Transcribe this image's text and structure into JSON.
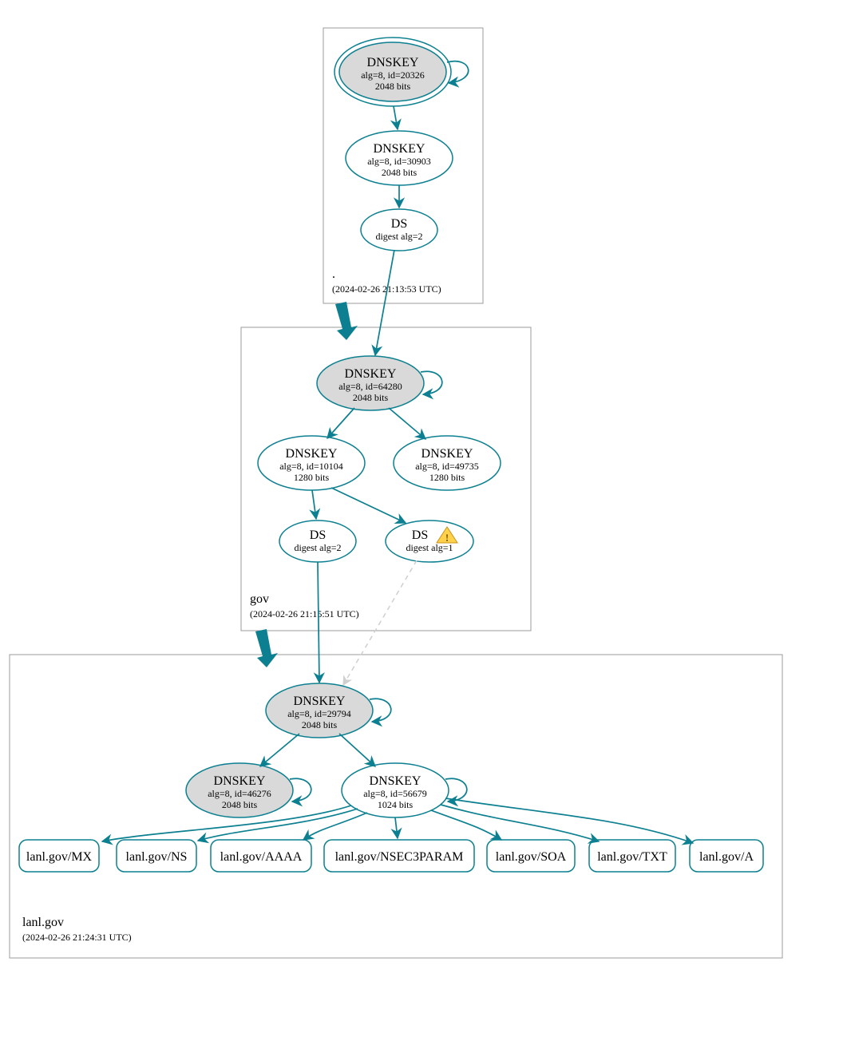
{
  "colors": {
    "stroke": "#0c8091",
    "shaded": "#d9d9d9",
    "box": "#9b9b9b",
    "dashed": "#cfcfcf"
  },
  "zones": {
    "root": {
      "label": ".",
      "timestamp": "(2024-02-26 21:13:53 UTC)"
    },
    "gov": {
      "label": "gov",
      "timestamp": "(2024-02-26 21:15:51 UTC)"
    },
    "lanl": {
      "label": "lanl.gov",
      "timestamp": "(2024-02-26 21:24:31 UTC)"
    }
  },
  "nodes": {
    "root_ksk": {
      "title": "DNSKEY",
      "l1": "alg=8, id=20326",
      "l2": "2048 bits"
    },
    "root_zsk": {
      "title": "DNSKEY",
      "l1": "alg=8, id=30903",
      "l2": "2048 bits"
    },
    "root_ds": {
      "title": "DS",
      "l1": "digest alg=2"
    },
    "gov_ksk": {
      "title": "DNSKEY",
      "l1": "alg=8, id=64280",
      "l2": "2048 bits"
    },
    "gov_zsk1": {
      "title": "DNSKEY",
      "l1": "alg=8, id=10104",
      "l2": "1280 bits"
    },
    "gov_zsk2": {
      "title": "DNSKEY",
      "l1": "alg=8, id=49735",
      "l2": "1280 bits"
    },
    "gov_ds1": {
      "title": "DS",
      "l1": "digest alg=2"
    },
    "gov_ds2": {
      "title": "DS",
      "l1": "digest alg=1"
    },
    "lanl_ksk": {
      "title": "DNSKEY",
      "l1": "alg=8, id=29794",
      "l2": "2048 bits"
    },
    "lanl_zsk1": {
      "title": "DNSKEY",
      "l1": "alg=8, id=46276",
      "l2": "2048 bits"
    },
    "lanl_zsk2": {
      "title": "DNSKEY",
      "l1": "alg=8, id=56679",
      "l2": "1024 bits"
    }
  },
  "rrsets": {
    "mx": "lanl.gov/MX",
    "ns": "lanl.gov/NS",
    "aaaa": "lanl.gov/AAAA",
    "n3p": "lanl.gov/NSEC3PARAM",
    "soa": "lanl.gov/SOA",
    "txt": "lanl.gov/TXT",
    "a": "lanl.gov/A"
  },
  "chart_data": {
    "type": "diagram",
    "description": "DNSSEC authentication/delegation graph",
    "zones": [
      {
        "name": ".",
        "analyzed": "2024-02-26 21:13:53 UTC"
      },
      {
        "name": "gov",
        "analyzed": "2024-02-26 21:15:51 UTC"
      },
      {
        "name": "lanl.gov",
        "analyzed": "2024-02-26 21:24:31 UTC"
      }
    ],
    "nodes": [
      {
        "id": "root_ksk",
        "zone": ".",
        "type": "DNSKEY",
        "alg": 8,
        "key_id": 20326,
        "bits": 2048,
        "role": "KSK",
        "trust_anchor": true
      },
      {
        "id": "root_zsk",
        "zone": ".",
        "type": "DNSKEY",
        "alg": 8,
        "key_id": 30903,
        "bits": 2048,
        "role": "ZSK"
      },
      {
        "id": "root_ds",
        "zone": ".",
        "type": "DS",
        "digest_alg": 2
      },
      {
        "id": "gov_ksk",
        "zone": "gov",
        "type": "DNSKEY",
        "alg": 8,
        "key_id": 64280,
        "bits": 2048,
        "role": "KSK"
      },
      {
        "id": "gov_zsk1",
        "zone": "gov",
        "type": "DNSKEY",
        "alg": 8,
        "key_id": 10104,
        "bits": 1280,
        "role": "ZSK"
      },
      {
        "id": "gov_zsk2",
        "zone": "gov",
        "type": "DNSKEY",
        "alg": 8,
        "key_id": 49735,
        "bits": 1280,
        "role": "ZSK"
      },
      {
        "id": "gov_ds1",
        "zone": "gov",
        "type": "DS",
        "digest_alg": 2
      },
      {
        "id": "gov_ds2",
        "zone": "gov",
        "type": "DS",
        "digest_alg": 1,
        "status": "warning"
      },
      {
        "id": "lanl_ksk",
        "zone": "lanl.gov",
        "type": "DNSKEY",
        "alg": 8,
        "key_id": 29794,
        "bits": 2048,
        "role": "KSK"
      },
      {
        "id": "lanl_zsk1",
        "zone": "lanl.gov",
        "type": "DNSKEY",
        "alg": 8,
        "key_id": 46276,
        "bits": 2048,
        "role": "ZSK"
      },
      {
        "id": "lanl_zsk2",
        "zone": "lanl.gov",
        "type": "DNSKEY",
        "alg": 8,
        "key_id": 56679,
        "bits": 1024,
        "role": "ZSK"
      },
      {
        "id": "rr_mx",
        "zone": "lanl.gov",
        "type": "RRset",
        "name": "lanl.gov/MX"
      },
      {
        "id": "rr_ns",
        "zone": "lanl.gov",
        "type": "RRset",
        "name": "lanl.gov/NS"
      },
      {
        "id": "rr_aaaa",
        "zone": "lanl.gov",
        "type": "RRset",
        "name": "lanl.gov/AAAA"
      },
      {
        "id": "rr_n3p",
        "zone": "lanl.gov",
        "type": "RRset",
        "name": "lanl.gov/NSEC3PARAM"
      },
      {
        "id": "rr_soa",
        "zone": "lanl.gov",
        "type": "RRset",
        "name": "lanl.gov/SOA"
      },
      {
        "id": "rr_txt",
        "zone": "lanl.gov",
        "type": "RRset",
        "name": "lanl.gov/TXT"
      },
      {
        "id": "rr_a",
        "zone": "lanl.gov",
        "type": "RRset",
        "name": "lanl.gov/A"
      }
    ],
    "edges": [
      {
        "from": "root_ksk",
        "to": "root_ksk",
        "kind": "self-sign"
      },
      {
        "from": "root_ksk",
        "to": "root_zsk",
        "kind": "signs"
      },
      {
        "from": "root_zsk",
        "to": "root_ds",
        "kind": "signs"
      },
      {
        "from": "root_ds",
        "to": "gov_ksk",
        "kind": "delegation"
      },
      {
        "from": "gov_ksk",
        "to": "gov_ksk",
        "kind": "self-sign"
      },
      {
        "from": "gov_ksk",
        "to": "gov_zsk1",
        "kind": "signs"
      },
      {
        "from": "gov_ksk",
        "to": "gov_zsk2",
        "kind": "signs"
      },
      {
        "from": "gov_zsk1",
        "to": "gov_ds1",
        "kind": "signs"
      },
      {
        "from": "gov_zsk1",
        "to": "gov_ds2",
        "kind": "signs"
      },
      {
        "from": "gov_ds1",
        "to": "lanl_ksk",
        "kind": "delegation"
      },
      {
        "from": "gov_ds2",
        "to": "lanl_ksk",
        "kind": "delegation",
        "status": "insecure"
      },
      {
        "from": "lanl_ksk",
        "to": "lanl_ksk",
        "kind": "self-sign"
      },
      {
        "from": "lanl_ksk",
        "to": "lanl_zsk1",
        "kind": "signs"
      },
      {
        "from": "lanl_ksk",
        "to": "lanl_zsk2",
        "kind": "signs"
      },
      {
        "from": "lanl_zsk1",
        "to": "lanl_zsk1",
        "kind": "self-sign"
      },
      {
        "from": "lanl_zsk2",
        "to": "lanl_zsk2",
        "kind": "self-sign"
      },
      {
        "from": "lanl_zsk2",
        "to": "rr_mx",
        "kind": "signs"
      },
      {
        "from": "lanl_zsk2",
        "to": "rr_ns",
        "kind": "signs"
      },
      {
        "from": "lanl_zsk2",
        "to": "rr_aaaa",
        "kind": "signs"
      },
      {
        "from": "lanl_zsk2",
        "to": "rr_n3p",
        "kind": "signs"
      },
      {
        "from": "lanl_zsk2",
        "to": "rr_soa",
        "kind": "signs"
      },
      {
        "from": "lanl_zsk2",
        "to": "rr_txt",
        "kind": "signs"
      },
      {
        "from": "lanl_zsk2",
        "to": "rr_a",
        "kind": "signs"
      }
    ]
  }
}
